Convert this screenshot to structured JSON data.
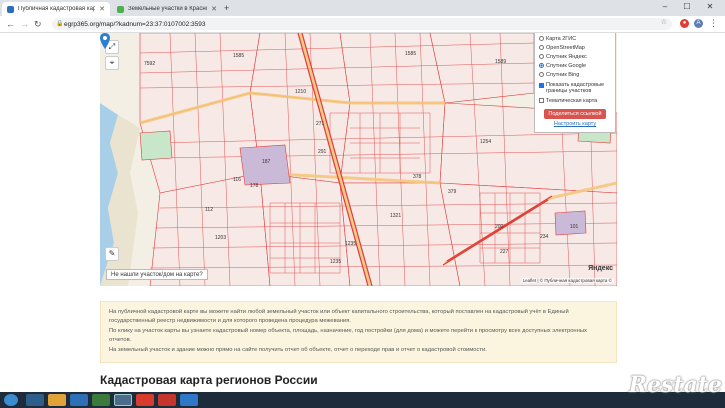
{
  "browser": {
    "tabs": [
      {
        "title": "Публичная кадастровая карта",
        "favicon_color": "#2a6fbd",
        "active": true
      },
      {
        "title": "Земельные участки в Краснод…",
        "favicon_color": "#4caf50",
        "active": false
      }
    ],
    "new_tab": "+",
    "address": "egrp365.org/map/?kadnum=23:37:0107002:3593",
    "controls": {
      "minimize": "–",
      "maximize": "☐",
      "close": "✕"
    }
  },
  "map": {
    "layers": [
      {
        "label": "Карта 2ГИС",
        "selected": false
      },
      {
        "label": "OpenStreetMap",
        "selected": false
      },
      {
        "label": "Спутник Яндекс",
        "selected": false
      },
      {
        "label": "Спутник Google",
        "selected": true
      },
      {
        "label": "Спутник Bing",
        "selected": false
      }
    ],
    "show_cadastral": {
      "label": "Показать кадастровые границы участков",
      "checked": true
    },
    "thematic": {
      "label": "Тематическая карта",
      "checked": false
    },
    "share_button": "Поделиться ссылкой",
    "setup_link": "Настроить карту",
    "not_found_button": "Не нашли участок/дом на карте?",
    "attribution": "Leaflet | © Публичная кадастровая карта ©",
    "provider": "Яндекс",
    "labels": [
      "7592",
      "1585",
      "1585",
      "187",
      "1589",
      "378",
      "379",
      "271",
      "291",
      "178",
      "112",
      "116",
      "1203",
      "1235",
      "1254",
      "1235",
      "200",
      "227",
      "234",
      "101",
      "1210",
      "1321"
    ]
  },
  "info": {
    "p1": "На публичной кадастровой карте вы можете найти любой земельный участок или объект капитального строительства, который поставлен на кадастровый учёт в Единый государственный реестр недвижимости и для которого проведена процедура межевания.",
    "p2": "По клику на участок карты вы узнаете кадастровый номер объекта, площадь, назначение, год постройки (для дома) и можете перейти к просмотру всех доступных электронных отчетов.",
    "p3": "На земельный участок и здание можно прямо на сайте получить отчет об объекте, отчет о переходе прав и отчет о кадастровой стоимости."
  },
  "heading": "Кадастровая карта регионов России",
  "watermark": "Restate",
  "colors": {
    "accent": "#d9534f",
    "sea": "#a9cfe8",
    "parcel": "#e03b3b"
  }
}
